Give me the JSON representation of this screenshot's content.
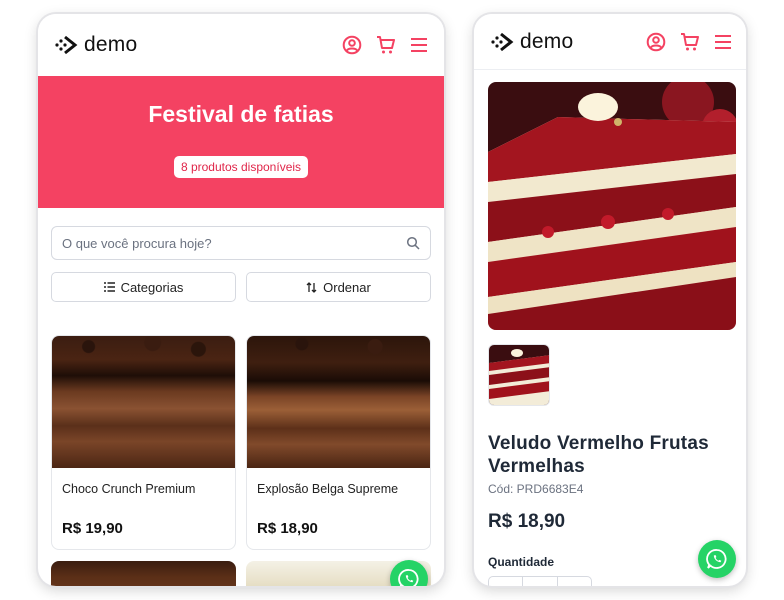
{
  "brand": {
    "name": "demo"
  },
  "colors": {
    "accent": "#f44262",
    "whatsapp": "#25d366"
  },
  "listing": {
    "hero_title": "Festival de fatias",
    "hero_badge": "8 produtos disponíveis",
    "search_placeholder": "O que você procura hoje?",
    "filters": {
      "categories": "Categorias",
      "sort": "Ordenar"
    },
    "products": [
      {
        "name": "Choco Crunch Premium",
        "price": "R$ 19,90"
      },
      {
        "name": "Explosão Belga Supreme",
        "price": "R$ 18,90"
      }
    ]
  },
  "detail": {
    "title": "Veludo Vermelho Frutas Vermelhas",
    "code": "Cód: PRD6683E4",
    "price": "R$ 18,90",
    "quantity_label": "Quantidade"
  },
  "icons": {
    "user": "user-circle-icon",
    "cart": "cart-icon",
    "menu": "hamburger-menu-icon",
    "search": "search-icon",
    "categories": "list-icon",
    "sort": "sort-arrows-icon",
    "whatsapp": "whatsapp-icon"
  }
}
